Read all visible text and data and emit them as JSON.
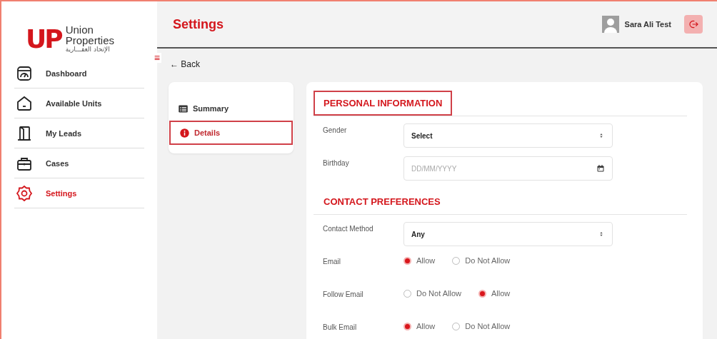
{
  "logo": {
    "mark": "UP",
    "name_line_1": "Union",
    "name_line_2": "Properties",
    "arabic": "الإتحاد العقـــارية"
  },
  "sidebar": {
    "toggle": "≡",
    "items": [
      {
        "label": "Dashboard",
        "selected": false
      },
      {
        "label": "Available Units",
        "selected": false
      },
      {
        "label": "My Leads",
        "selected": false
      },
      {
        "label": "Cases",
        "selected": false
      },
      {
        "label": "Settings",
        "selected": true
      }
    ]
  },
  "header": {
    "title": "Settings",
    "user": "Sara Ali Test"
  },
  "back": {
    "arrow": "←",
    "label": "Back"
  },
  "tabs": [
    {
      "label": "Summary",
      "selected": false,
      "highlighted": false
    },
    {
      "label": "Details",
      "selected": true,
      "highlighted": true
    }
  ],
  "sections": [
    {
      "title": "PERSONAL INFORMATION",
      "highlighted": true,
      "fields": [
        {
          "kind": "select",
          "label": "Gender",
          "value": "Select"
        },
        {
          "kind": "date",
          "label": "Birthday",
          "placeholder": "DD/MM/YYYY"
        }
      ]
    },
    {
      "title": "CONTACT PREFERENCES",
      "highlighted": false,
      "fields": [
        {
          "kind": "select",
          "label": "Contact Method",
          "value": "Any"
        },
        {
          "kind": "radio",
          "label": "Email",
          "options": [
            {
              "label": "Allow",
              "selected": true
            },
            {
              "label": "Do Not Allow",
              "selected": false
            }
          ]
        },
        {
          "kind": "radio",
          "label": "Follow Email",
          "options": [
            {
              "label": "Do Not Allow",
              "selected": false
            },
            {
              "label": "Allow",
              "selected": true
            }
          ]
        },
        {
          "kind": "radio",
          "label": "Bulk Email",
          "options": [
            {
              "label": "Allow",
              "selected": true
            },
            {
              "label": "Do Not Allow",
              "selected": false
            }
          ]
        }
      ]
    }
  ]
}
